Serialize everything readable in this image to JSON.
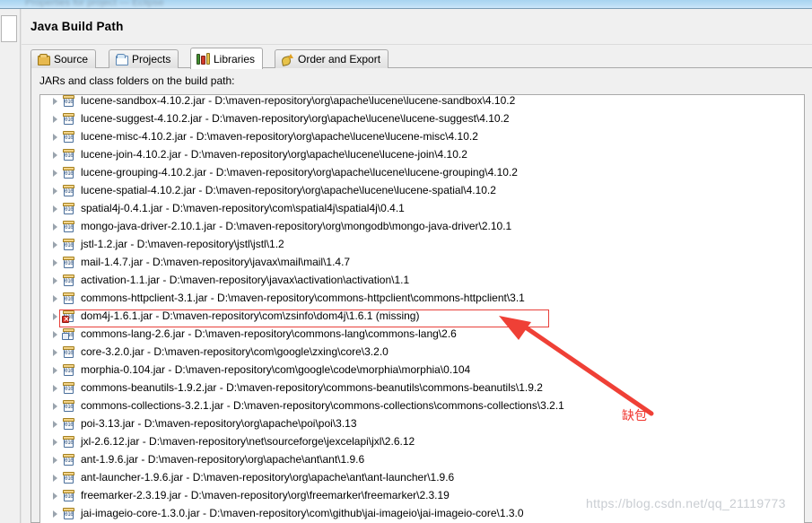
{
  "window": {
    "ghost_title": "Properties for project — Eclipse"
  },
  "dialog": {
    "title": "Java Build Path"
  },
  "tabs": [
    {
      "label": "Source",
      "icon": "package-icon",
      "active": false
    },
    {
      "label": "Projects",
      "icon": "folder-icon",
      "active": false
    },
    {
      "label": "Libraries",
      "icon": "books-icon",
      "active": true
    },
    {
      "label": "Order and Export",
      "icon": "order-export-icon",
      "active": false
    }
  ],
  "content": {
    "caption": "JARs and class folders on the build path:"
  },
  "jars": [
    {
      "name": "lucene-sandbox-4.10.2.jar",
      "sep": " - ",
      "path": "D:\\maven-repository\\org\\apache\\lucene\\lucene-sandbox\\4.10.2",
      "state": "ok"
    },
    {
      "name": "lucene-suggest-4.10.2.jar",
      "sep": " - ",
      "path": "D:\\maven-repository\\org\\apache\\lucene\\lucene-suggest\\4.10.2",
      "state": "ok"
    },
    {
      "name": "lucene-misc-4.10.2.jar",
      "sep": " - ",
      "path": "D:\\maven-repository\\org\\apache\\lucene\\lucene-misc\\4.10.2",
      "state": "ok"
    },
    {
      "name": "lucene-join-4.10.2.jar",
      "sep": " - ",
      "path": "D:\\maven-repository\\org\\apache\\lucene\\lucene-join\\4.10.2",
      "state": "ok"
    },
    {
      "name": "lucene-grouping-4.10.2.jar",
      "sep": " - ",
      "path": "D:\\maven-repository\\org\\apache\\lucene\\lucene-grouping\\4.10.2",
      "state": "ok"
    },
    {
      "name": "lucene-spatial-4.10.2.jar",
      "sep": " - ",
      "path": "D:\\maven-repository\\org\\apache\\lucene\\lucene-spatial\\4.10.2",
      "state": "ok"
    },
    {
      "name": "spatial4j-0.4.1.jar",
      "sep": " - ",
      "path": "D:\\maven-repository\\com\\spatial4j\\spatial4j\\0.4.1",
      "state": "ok"
    },
    {
      "name": "mongo-java-driver-2.10.1.jar",
      "sep": " - ",
      "path": "D:\\maven-repository\\org\\mongodb\\mongo-java-driver\\2.10.1",
      "state": "ok"
    },
    {
      "name": "jstl-1.2.jar",
      "sep": " - ",
      "path": "D:\\maven-repository\\jstl\\jstl\\1.2",
      "state": "ok"
    },
    {
      "name": "mail-1.4.7.jar",
      "sep": " - ",
      "path": "D:\\maven-repository\\javax\\mail\\mail\\1.4.7",
      "state": "ok"
    },
    {
      "name": "activation-1.1.jar",
      "sep": " - ",
      "path": "D:\\maven-repository\\javax\\activation\\activation\\1.1",
      "state": "ok"
    },
    {
      "name": "commons-httpclient-3.1.jar",
      "sep": " - ",
      "path": "D:\\maven-repository\\commons-httpclient\\commons-httpclient\\3.1",
      "state": "ok"
    },
    {
      "name": "dom4j-1.6.1.jar",
      "sep": " - ",
      "path": "D:\\maven-repository\\com\\zsinfo\\dom4j\\1.6.1 (missing)",
      "state": "missing"
    },
    {
      "name": "commons-lang-2.6.jar",
      "sep": " - ",
      "path": "D:\\maven-repository\\commons-lang\\commons-lang\\2.6",
      "state": "source"
    },
    {
      "name": "core-3.2.0.jar",
      "sep": " - ",
      "path": "D:\\maven-repository\\com\\google\\zxing\\core\\3.2.0",
      "state": "ok"
    },
    {
      "name": "morphia-0.104.jar",
      "sep": " - ",
      "path": "D:\\maven-repository\\com\\google\\code\\morphia\\morphia\\0.104",
      "state": "ok"
    },
    {
      "name": "commons-beanutils-1.9.2.jar",
      "sep": " - ",
      "path": "D:\\maven-repository\\commons-beanutils\\commons-beanutils\\1.9.2",
      "state": "ok"
    },
    {
      "name": "commons-collections-3.2.1.jar",
      "sep": " - ",
      "path": "D:\\maven-repository\\commons-collections\\commons-collections\\3.2.1",
      "state": "ok"
    },
    {
      "name": "poi-3.13.jar",
      "sep": " - ",
      "path": "D:\\maven-repository\\org\\apache\\poi\\poi\\3.13",
      "state": "ok"
    },
    {
      "name": "jxl-2.6.12.jar",
      "sep": " - ",
      "path": "D:\\maven-repository\\net\\sourceforge\\jexcelapi\\jxl\\2.6.12",
      "state": "ok"
    },
    {
      "name": "ant-1.9.6.jar",
      "sep": " - ",
      "path": "D:\\maven-repository\\org\\apache\\ant\\ant\\1.9.6",
      "state": "ok"
    },
    {
      "name": "ant-launcher-1.9.6.jar",
      "sep": " - ",
      "path": "D:\\maven-repository\\org\\apache\\ant\\ant-launcher\\1.9.6",
      "state": "ok"
    },
    {
      "name": "freemarker-2.3.19.jar",
      "sep": " - ",
      "path": "D:\\maven-repository\\org\\freemarker\\freemarker\\2.3.19",
      "state": "ok"
    },
    {
      "name": "jai-imageio-core-1.3.0.jar",
      "sep": " - ",
      "path": "D:\\maven-repository\\com\\github\\jai-imageio\\jai-imageio-core\\1.3.0",
      "state": "ok"
    }
  ],
  "annotation": {
    "text": "缺包",
    "color": "#f0372f",
    "highlight_color": "#e8403a",
    "highlighted_row": "dom4j-1.6.1.jar"
  },
  "watermark": {
    "text": "https://blog.csdn.net/qq_21119773"
  }
}
